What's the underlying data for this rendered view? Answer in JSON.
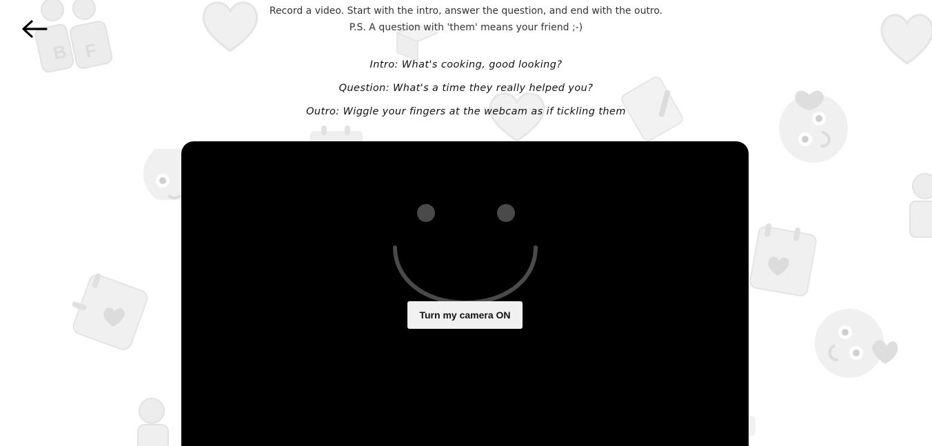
{
  "instructions": {
    "line1": "Record a video. Start with the intro, answer the question, and end with the outro.",
    "line2": "P.S. A question with 'them' means your friend ;-)"
  },
  "prompts": {
    "intro": "Intro: What's cooking, good looking?",
    "question": "Question: What's a time they really helped you?",
    "outro": "Outro: Wiggle your fingers at the webcam as if tickling them"
  },
  "camera": {
    "button_label": "Turn my camera ON"
  },
  "icons": {
    "back": "arrow-left-icon",
    "placeholder": "smiley-icon"
  },
  "colors": {
    "background": "#ffffff",
    "camera_frame": "#000000",
    "button_bg": "#f1f1f1",
    "decor": "#efefef",
    "smiley": "#4a4a4a"
  }
}
